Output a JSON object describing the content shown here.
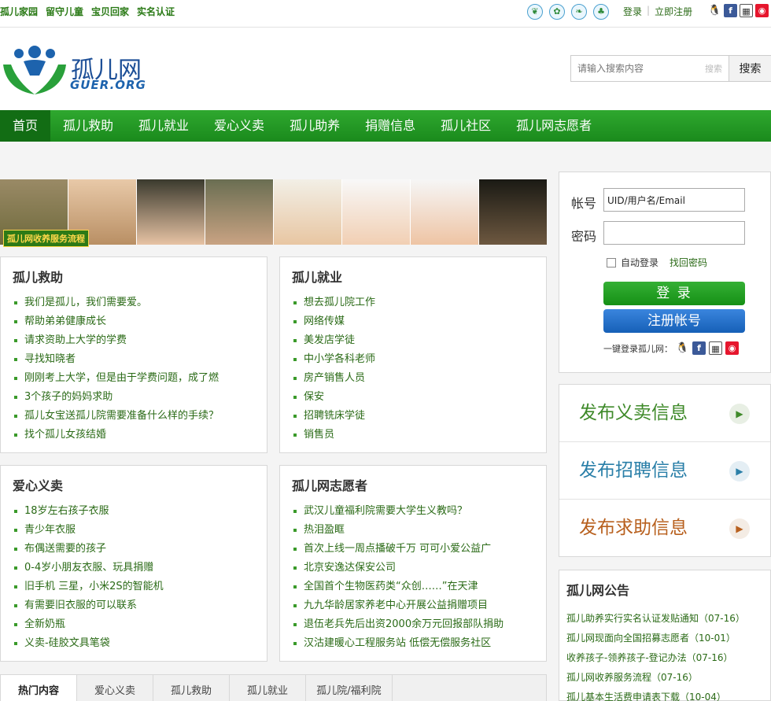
{
  "top": {
    "links": [
      "孤儿家园",
      "留守儿童",
      "宝贝回家",
      "实名认证"
    ],
    "login_label": "登录",
    "register_label": "立即注册"
  },
  "header": {
    "logo_title": "孤儿网",
    "logo_subtitle": "GUER.ORG",
    "search_placeholder": "请输入搜索内容",
    "search_hint": "搜索",
    "search_button": "搜索"
  },
  "nav": {
    "items": [
      "首页",
      "孤儿救助",
      "孤儿就业",
      "爱心义卖",
      "孤儿助养",
      "捐赠信息",
      "孤儿社区",
      "孤儿网志愿者"
    ]
  },
  "banner": {
    "label": "孤儿网收养服务流程"
  },
  "sections": {
    "rescue": {
      "title": "孤儿救助",
      "items": [
        "我们是孤儿，我们需要爱。",
        "帮助弟弟健康成长",
        "请求资助上大学的学费",
        "寻找知晓者",
        "刚刚考上大学，但是由于学费问题，成了燃",
        "3个孩子的妈妈求助",
        "孤儿女宝送孤儿院需要准备什么样的手续？",
        "找个孤儿女孩结婚"
      ]
    },
    "employment": {
      "title": "孤儿就业",
      "items": [
        "想去孤儿院工作",
        "网络传媒",
        "美发店学徒",
        "中小学各科老师",
        "房产销售人员",
        "保安",
        "招聘铣床学徒",
        "销售员"
      ]
    },
    "charity": {
      "title": "爱心义卖",
      "items": [
        "18岁左右孩子衣服",
        "青少年衣服",
        "布偶送需要的孩子",
        "0-4岁小朋友衣服、玩具捐赠",
        "旧手机 三星，小米2S的智能机",
        "有需要旧衣服的可以联系",
        "全新奶瓶",
        "义卖-硅胶文具笔袋"
      ]
    },
    "volunteers": {
      "title": "孤儿网志愿者",
      "items": [
        "武汉儿童福利院需要大学生义教吗？",
        "热泪盈眶",
        "首次上线一周点播破千万 可可小爱公益广",
        "北京安逸达保安公司",
        "全国首个生物医药类“众创……”在天津",
        "九九华龄居家养老中心开展公益捐赠项目",
        "退伍老兵先后出资2000余万元回报部队捐助",
        "汉沽建暖心工程服务站 低偿无偿服务社区"
      ]
    }
  },
  "login": {
    "account_label": "帐号",
    "account_value": "UID/用户名/Email",
    "password_label": "密码",
    "remember_label": "自动登录",
    "forgot_label": "找回密码",
    "login_button": "登 录",
    "register_button": "注册帐号",
    "onekey_label": "一键登录孤儿网："
  },
  "publish": {
    "items": [
      "发布义卖信息",
      "发布招聘信息",
      "发布求助信息"
    ],
    "colors": [
      "#3f8a2a",
      "#2a7fa8",
      "#b8601e"
    ]
  },
  "notice": {
    "title": "孤儿网公告",
    "items": [
      "孤儿助养实行实名认证发贴通知（07-16）",
      "孤儿网现面向全国招募志愿者（10-01）",
      "收养孩子-领养孩子-登记办法（07-16）",
      "孤儿网收养服务流程（07-16）",
      "孤儿基本生活费申请表下载（10-04）"
    ]
  },
  "tabs": [
    "热门内容",
    "爱心义卖",
    "孤儿救助",
    "孤儿就业",
    "孤儿院/福利院"
  ],
  "colors": {
    "nav_green": "#1a8a1c",
    "link_green": "#2a6a16",
    "brand_blue": "#1d4f97"
  }
}
